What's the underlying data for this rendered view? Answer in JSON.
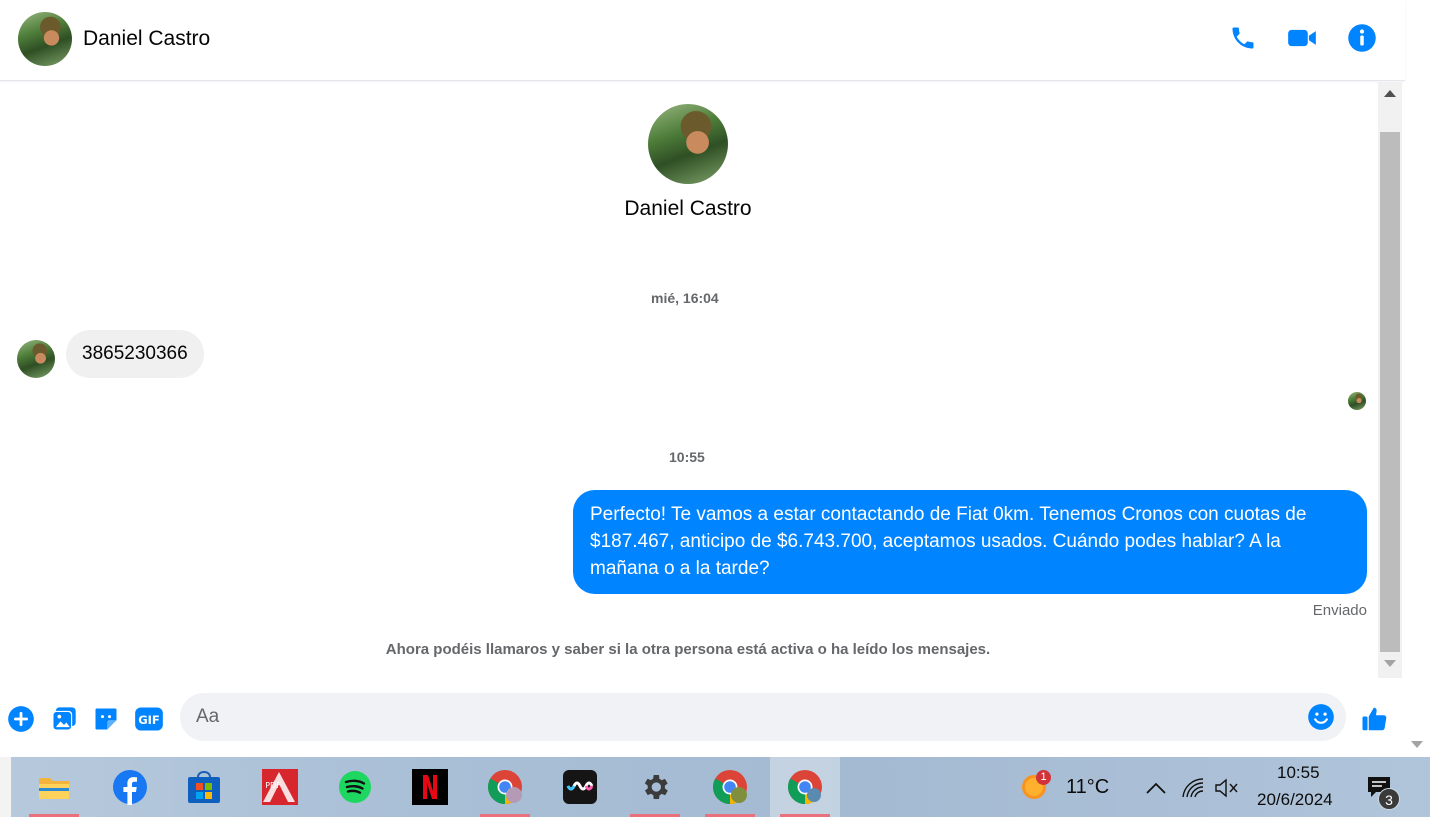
{
  "header": {
    "contact_name": "Daniel Castro"
  },
  "profile": {
    "name": "Daniel Castro"
  },
  "thread": {
    "timestamp_1": "mié, 16:04",
    "incoming_message": "3865230366",
    "timestamp_2": "10:55",
    "outgoing_message": "Perfecto! Te vamos a estar contactando de Fiat 0km. Tenemos Cronos con cuotas de $187.467, anticipo de $6.743.700, aceptamos usados. Cuándo podes hablar? A la mañana o a la tarde?",
    "sent_status": "Enviado",
    "info_note": "Ahora podéis llamaros y saber si la otra persona está activa o ha leído los mensajes."
  },
  "composer": {
    "placeholder": "Aa"
  },
  "taskbar": {
    "apps": [
      "file-explorer",
      "facebook",
      "microsoft-store",
      "pdf-x",
      "spotify",
      "netflix",
      "chrome",
      "app-wavy",
      "settings",
      "chrome",
      "chrome"
    ],
    "pdf_label": "PDF",
    "weather_badge": "1",
    "temperature": "11°C",
    "time": "10:55",
    "date": "20/6/2024",
    "notifications_count": "3"
  },
  "colors": {
    "accent": "#0084ff",
    "incoming_bubble": "#f0f0f0"
  }
}
